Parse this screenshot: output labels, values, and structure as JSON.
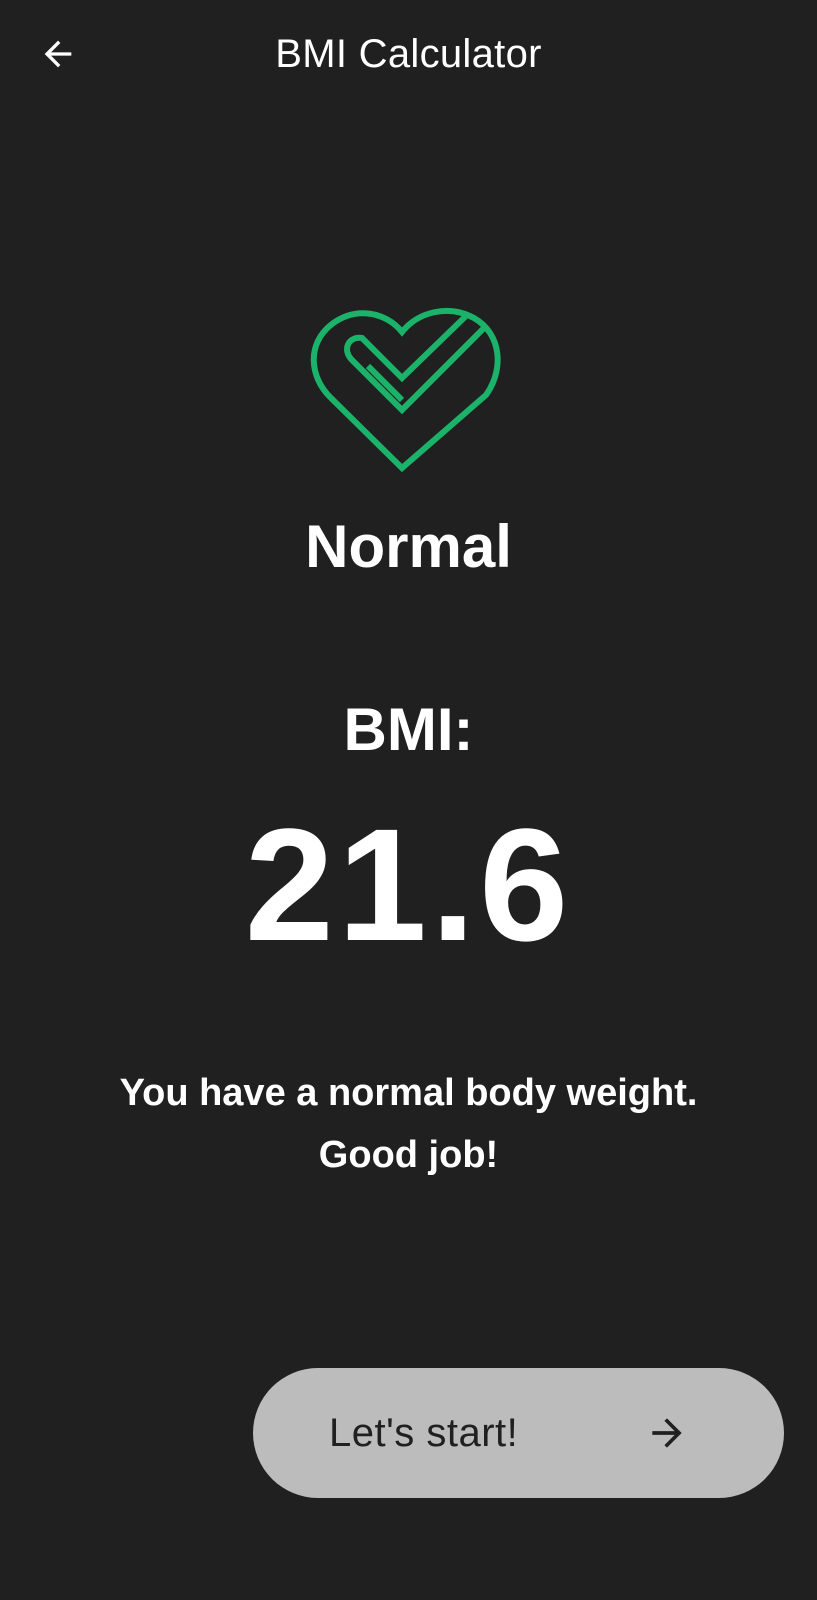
{
  "app_bar": {
    "title": "BMI Calculator",
    "back_icon": "arrow-back-icon"
  },
  "result": {
    "status_icon": "heart-check-icon",
    "status_color": "#1bb36a",
    "status": "Normal",
    "bmi_label": "BMI:",
    "bmi_value": "21.6",
    "message_line1": "You have a normal body weight.",
    "message_line2": "Good job!"
  },
  "action": {
    "label": "Let's start!",
    "icon": "arrow-forward-icon",
    "background": "#bcbcbc"
  }
}
